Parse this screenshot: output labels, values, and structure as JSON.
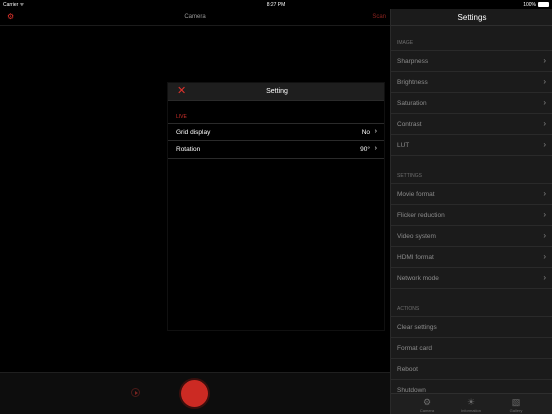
{
  "status_bar": {
    "carrier": "Carrier ᯤ",
    "time": "8:27 PM",
    "battery": "100%"
  },
  "camera": {
    "title": "Camera",
    "scan_label": "Scan",
    "settings_icon": "gear-icon",
    "colors": {
      "accent": "#e0322c",
      "record": "#cc2a23"
    }
  },
  "dialog": {
    "title": "Setting",
    "close_glyph": "✕",
    "section": "LIVE",
    "rows": [
      {
        "label": "Grid display",
        "value": "No"
      },
      {
        "label": "Rotation",
        "value": "90°"
      }
    ]
  },
  "panel": {
    "title": "Settings",
    "groups": [
      {
        "label": "IMAGE",
        "items": [
          "Sharpness",
          "Brightness",
          "Saturation",
          "Contrast",
          "LUT"
        ],
        "chevrons": true
      },
      {
        "label": "SETTINGS",
        "items": [
          "Movie format",
          "Flicker reduction",
          "Video system",
          "HDMI format",
          "Network mode"
        ],
        "chevrons": true
      },
      {
        "label": "ACTIONS",
        "items": [
          "Clear settings",
          "Format card",
          "Reboot",
          "Shutdown"
        ],
        "chevrons": false
      }
    ],
    "tabs": [
      {
        "label": "Camera",
        "icon": "gear-icon"
      },
      {
        "label": "Information",
        "icon": "sun-icon"
      },
      {
        "label": "Gallery",
        "icon": "gallery-icon"
      }
    ]
  }
}
